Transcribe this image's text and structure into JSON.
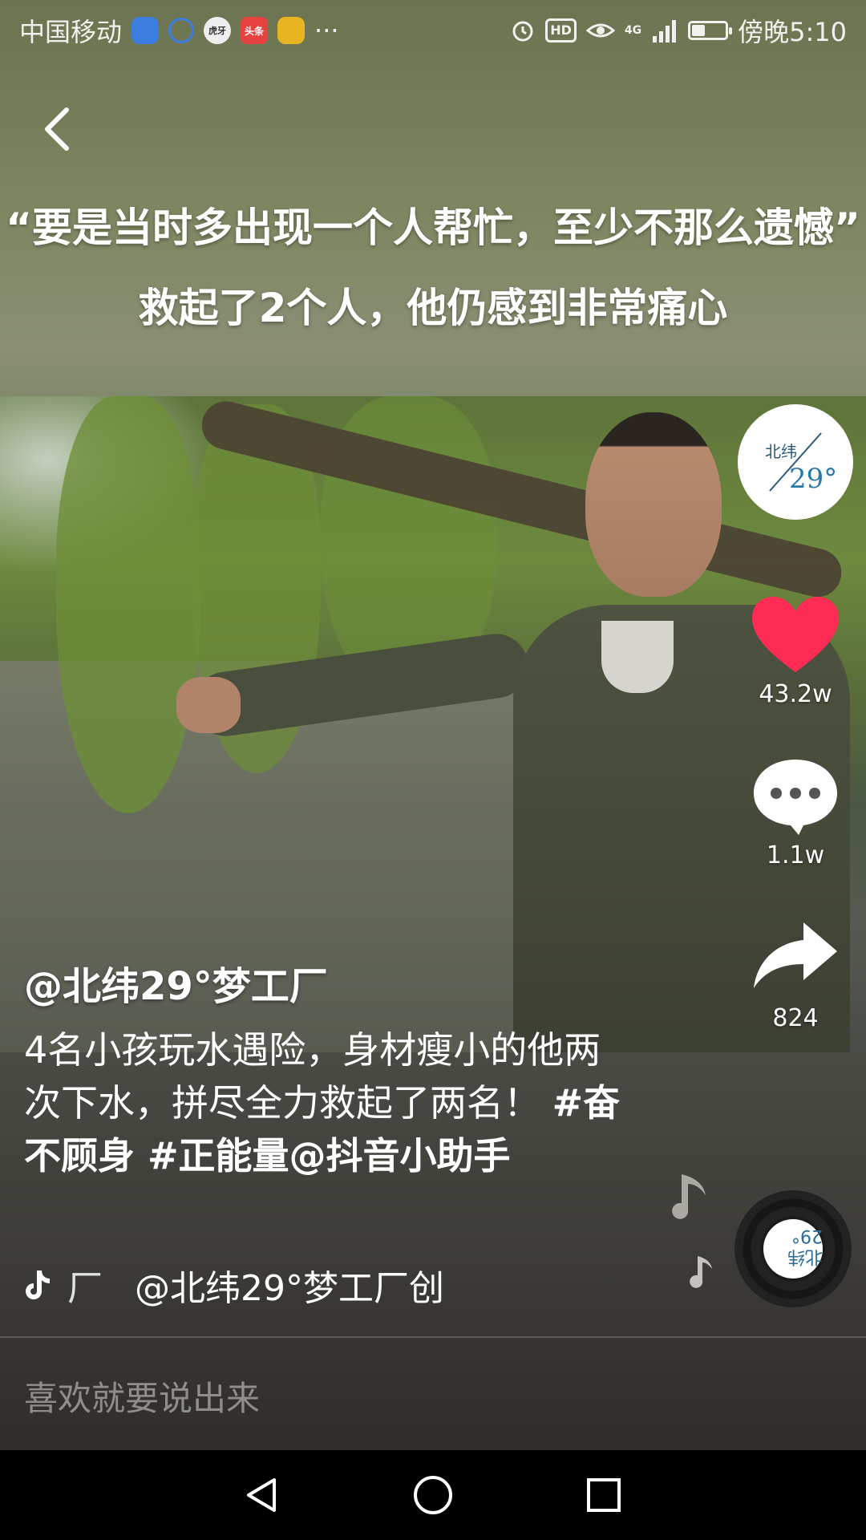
{
  "status_bar": {
    "carrier": "中国移动",
    "app_icons": [
      "qq-icon",
      "push-to-talk-icon",
      "huya-icon",
      "toutiao-icon",
      "fish-icon"
    ],
    "huya_label": "虎牙",
    "toutiao_label": "头条",
    "more": "···",
    "network": "4G",
    "hd": "HD",
    "battery_level": 0.4,
    "time": "傍晚5:10"
  },
  "video": {
    "caption_line1": "“要是当时多出现一个人帮忙，至少不那么遗憾”",
    "caption_line2": "救起了2个人，他仍感到非常痛心"
  },
  "rail": {
    "avatar_text_top": "北纬",
    "avatar_text_num": "29°",
    "likes": "43.2w",
    "comments": "1.1w",
    "shares": "824",
    "record_label": "北纬29°"
  },
  "post": {
    "author": "@北纬29°梦工厂",
    "description_plain": "4名小孩玩水遇险，身材瘦小的他两次下水，拼尽全力救起了两名！ ",
    "tag1": "#奋不顾身",
    "tag2": " #正能量@抖音小助手",
    "music_prefix": "厂",
    "music": "@北纬29°梦工厂创"
  },
  "comment_box": {
    "placeholder": "喜欢就要说出来"
  },
  "colors": {
    "like_red": "#fe2c55",
    "comment_white": "#ffffff"
  }
}
